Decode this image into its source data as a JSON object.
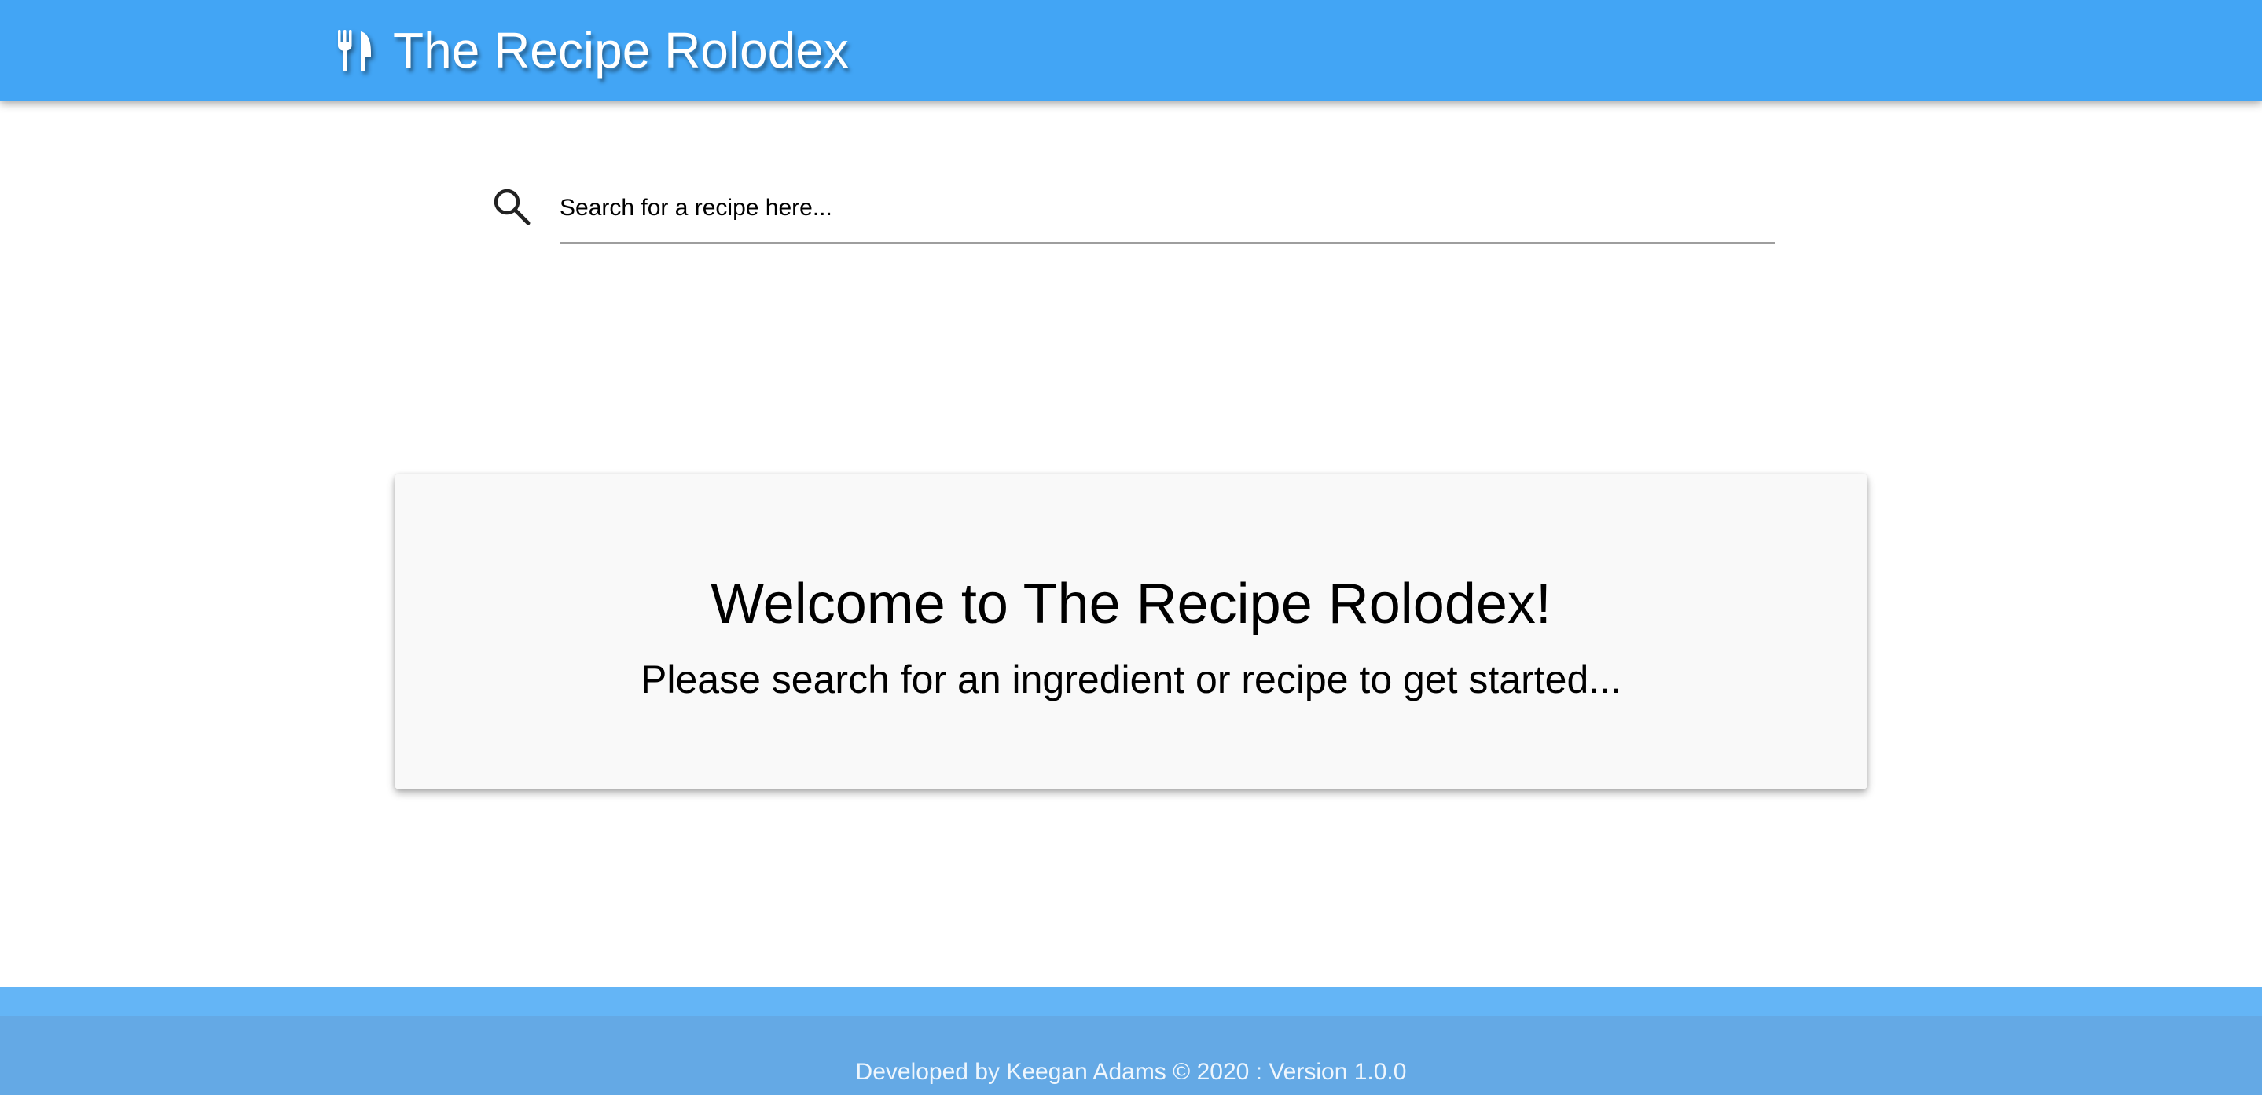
{
  "header": {
    "title": "The Recipe Rolodex",
    "logo_icon": "fork-knife-icon",
    "background_color": "#42a5f5"
  },
  "search": {
    "icon": "search-icon",
    "placeholder": "Search for a recipe here...",
    "value": ""
  },
  "welcome": {
    "title": "Welcome to The Recipe Rolodex!",
    "subtitle": "Please search for an ingredient or recipe to get started..."
  },
  "footer": {
    "text": "Developed by Keegan Adams © 2020 : Version 1.0.0",
    "color": "#64b5f6"
  }
}
